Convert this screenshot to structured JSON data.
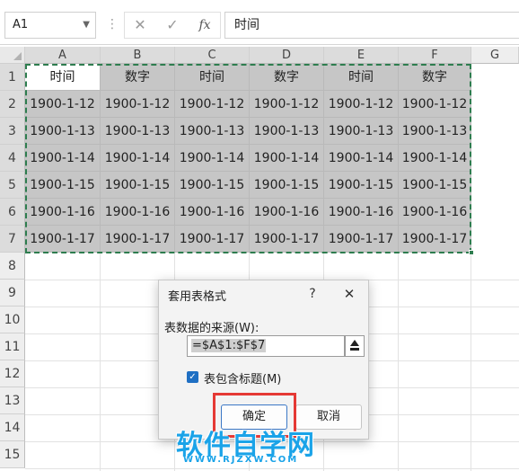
{
  "formula_bar": {
    "name_box": "A1",
    "cancel_icon": "x-icon",
    "confirm_icon": "check-icon",
    "fx_label": "fx",
    "formula": "时间"
  },
  "sheet": {
    "columns": [
      "A",
      "B",
      "C",
      "D",
      "E",
      "F",
      "G"
    ],
    "rows": [
      "1",
      "2",
      "3",
      "4",
      "5",
      "6",
      "7",
      "8",
      "9",
      "10",
      "11",
      "12",
      "13",
      "14",
      "15"
    ],
    "cells": [
      [
        "时间",
        "数字",
        "时间",
        "数字",
        "时间",
        "数字"
      ],
      [
        "1900-1-12",
        "1900-1-12",
        "1900-1-12",
        "1900-1-12",
        "1900-1-12",
        "1900-1-12"
      ],
      [
        "1900-1-13",
        "1900-1-13",
        "1900-1-13",
        "1900-1-13",
        "1900-1-13",
        "1900-1-13"
      ],
      [
        "1900-1-14",
        "1900-1-14",
        "1900-1-14",
        "1900-1-14",
        "1900-1-14",
        "1900-1-14"
      ],
      [
        "1900-1-15",
        "1900-1-15",
        "1900-1-15",
        "1900-1-15",
        "1900-1-15",
        "1900-1-15"
      ],
      [
        "1900-1-16",
        "1900-1-16",
        "1900-1-16",
        "1900-1-16",
        "1900-1-16",
        "1900-1-16"
      ],
      [
        "1900-1-17",
        "1900-1-17",
        "1900-1-17",
        "1900-1-17",
        "1900-1-17",
        "1900-1-17"
      ]
    ]
  },
  "dialog": {
    "title": "套用表格式",
    "help": "?",
    "close": "✕",
    "source_label": "表数据的来源(W):",
    "source_value": "=$A$1:$F$7",
    "has_headers_checked": true,
    "has_headers_label": "表包含标题(M)",
    "ok_label": "确定",
    "cancel_label": "取消"
  },
  "watermark": {
    "text": "软件自学网",
    "url": "WWW.RJZXW.COM"
  },
  "colors": {
    "selection": "#c6c6c6",
    "marquee": "#2e7d4f",
    "accent": "#1f6fc3",
    "annotation": "#e53935",
    "watermark": "#1aa3e8"
  }
}
